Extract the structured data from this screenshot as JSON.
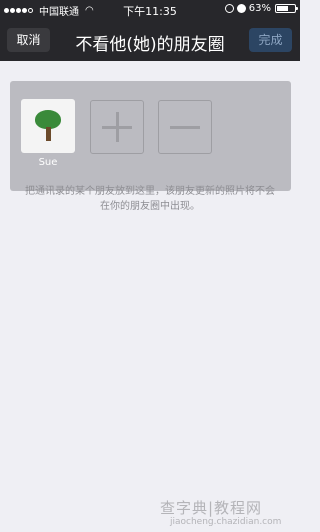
{
  "status_bar": {
    "signal_dots_filled": 4,
    "signal_dots_total": 5,
    "carrier": "中国联通",
    "time": "下午11:35",
    "battery": "63%",
    "battery_level": 0.63
  },
  "nav": {
    "cancel_label": "取消",
    "title": "不看他(她)的朋友圈",
    "done_label": "完成",
    "done_enabled": false
  },
  "members": [
    {
      "name": "Sue",
      "avatar": "tree-icon"
    }
  ],
  "actions": {
    "add_icon": "plus-icon",
    "remove_icon": "minus-icon"
  },
  "hint": "把通讯录的某个朋友放到这里，该朋友更新的照片将不会在你的朋友圈中出现。",
  "watermark": {
    "main": "查字典|教程网",
    "sub": "jiaocheng.chazidian.com"
  },
  "colors": {
    "nav_background": "#27272b",
    "page_background": "#efeff4",
    "panel_background": "#bbbbc1",
    "done_button": "#2c4563"
  }
}
